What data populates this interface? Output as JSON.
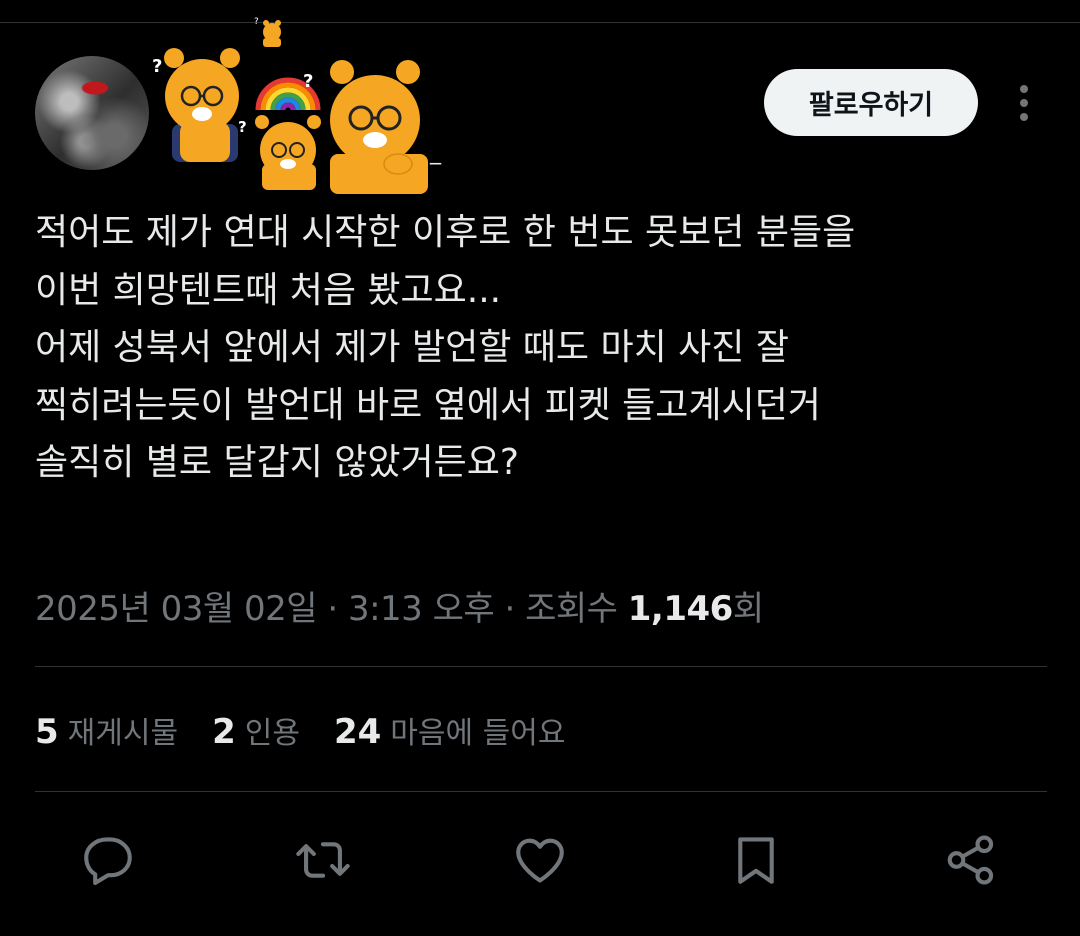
{
  "tweet": {
    "text": "적어도 제가 연대 시작한 이후로 한 번도 못보던 분들을\n이번 희망텐트때 처음 봤고요...\n어제 성북서 앞에서 제가 발언할 때도 마치 사진 잘\n찍히려는듯이 발언대 바로 옆에서 피켓 들고계시던거\n솔직히 별로 달갑지 않았거든요?",
    "date": "2025년 03월 02일",
    "separator": "·",
    "time": "3:13 오후",
    "views_label": "조회수",
    "views_count": "1,146",
    "views_suffix": "회"
  },
  "header": {
    "follow_label": "팔로우하기",
    "username_suffix": "_"
  },
  "stats": {
    "reposts_count": "5",
    "reposts_label": "재게시물",
    "quotes_count": "2",
    "quotes_label": "인용",
    "likes_count": "24",
    "likes_label": "마음에 들어요"
  },
  "icons": {
    "avatar": "profile-avatar",
    "more": "more-vertical-icon",
    "reply": "reply-icon",
    "repost": "repost-icon",
    "like": "heart-icon",
    "bookmark": "bookmark-icon",
    "share": "share-icon"
  },
  "colors": {
    "background": "#000000",
    "text": "#e7e9ea",
    "muted": "#71767b",
    "divider": "#2f3336",
    "follow_button_bg": "#eff3f4",
    "character_orange": "#f5a623"
  }
}
